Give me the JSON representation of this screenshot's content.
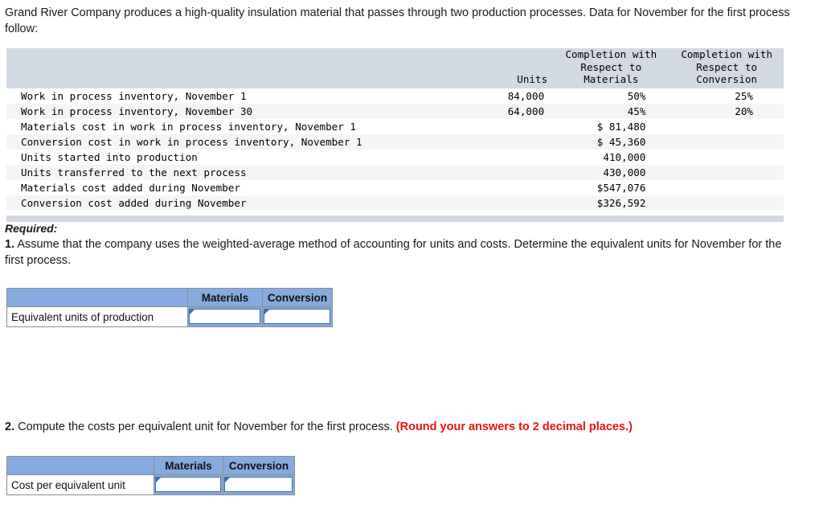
{
  "intro": {
    "text": "Grand River Company produces a high-quality insulation material that passes through two production processes. Data for November for the first process follow:"
  },
  "data_table": {
    "headers": {
      "label": "",
      "units": "Units",
      "materials": "Completion with\nRespect to\nMaterials",
      "conversion": "Completion with\nRespect to\nConversion"
    },
    "rows": [
      {
        "label": "Work in process inventory, November 1",
        "units": "84,000",
        "materials": "50%",
        "conversion": "25%"
      },
      {
        "label": "Work in process inventory, November 30",
        "units": "64,000",
        "materials": "45%",
        "conversion": "20%"
      },
      {
        "label": "Materials cost in work in process inventory, November 1",
        "units": "",
        "materials": "$ 81,480",
        "conversion": ""
      },
      {
        "label": "Conversion cost in work in process inventory, November 1",
        "units": "",
        "materials": "$ 45,360",
        "conversion": ""
      },
      {
        "label": "Units started into production",
        "units": "",
        "materials": "410,000",
        "conversion": ""
      },
      {
        "label": "Units transferred to the next process",
        "units": "",
        "materials": "430,000",
        "conversion": ""
      },
      {
        "label": "Materials cost added during November",
        "units": "",
        "materials": "$547,076",
        "conversion": ""
      },
      {
        "label": "Conversion cost added during November",
        "units": "",
        "materials": "$326,592",
        "conversion": ""
      }
    ]
  },
  "required": {
    "heading": "Required:",
    "q1_number": "1.",
    "q1_text": " Assume that the company uses the weighted-average method of accounting for units and costs. Determine the equivalent units for November for the first process.",
    "q2_number": "2.",
    "q2_text": " Compute the costs per equivalent unit for November for the first process. ",
    "q2_note": "(Round your answers to 2 decimal places.)"
  },
  "answer_table_1": {
    "col0_header": "",
    "col1_header": "Materials",
    "col2_header": "Conversion",
    "row_label": "Equivalent units of production",
    "materials_value": "",
    "conversion_value": ""
  },
  "answer_table_2": {
    "col0_header": "",
    "col1_header": "Materials",
    "col2_header": "Conversion",
    "row_label": "Cost per equivalent unit",
    "materials_value": "",
    "conversion_value": ""
  },
  "colors": {
    "data_header_bg": "#d3d9e3",
    "answer_header_bg": "#84aadf",
    "input_border": "#3b6fb0",
    "note_red": "#ee1111",
    "row_alt_bg": "#f5f5f7"
  }
}
